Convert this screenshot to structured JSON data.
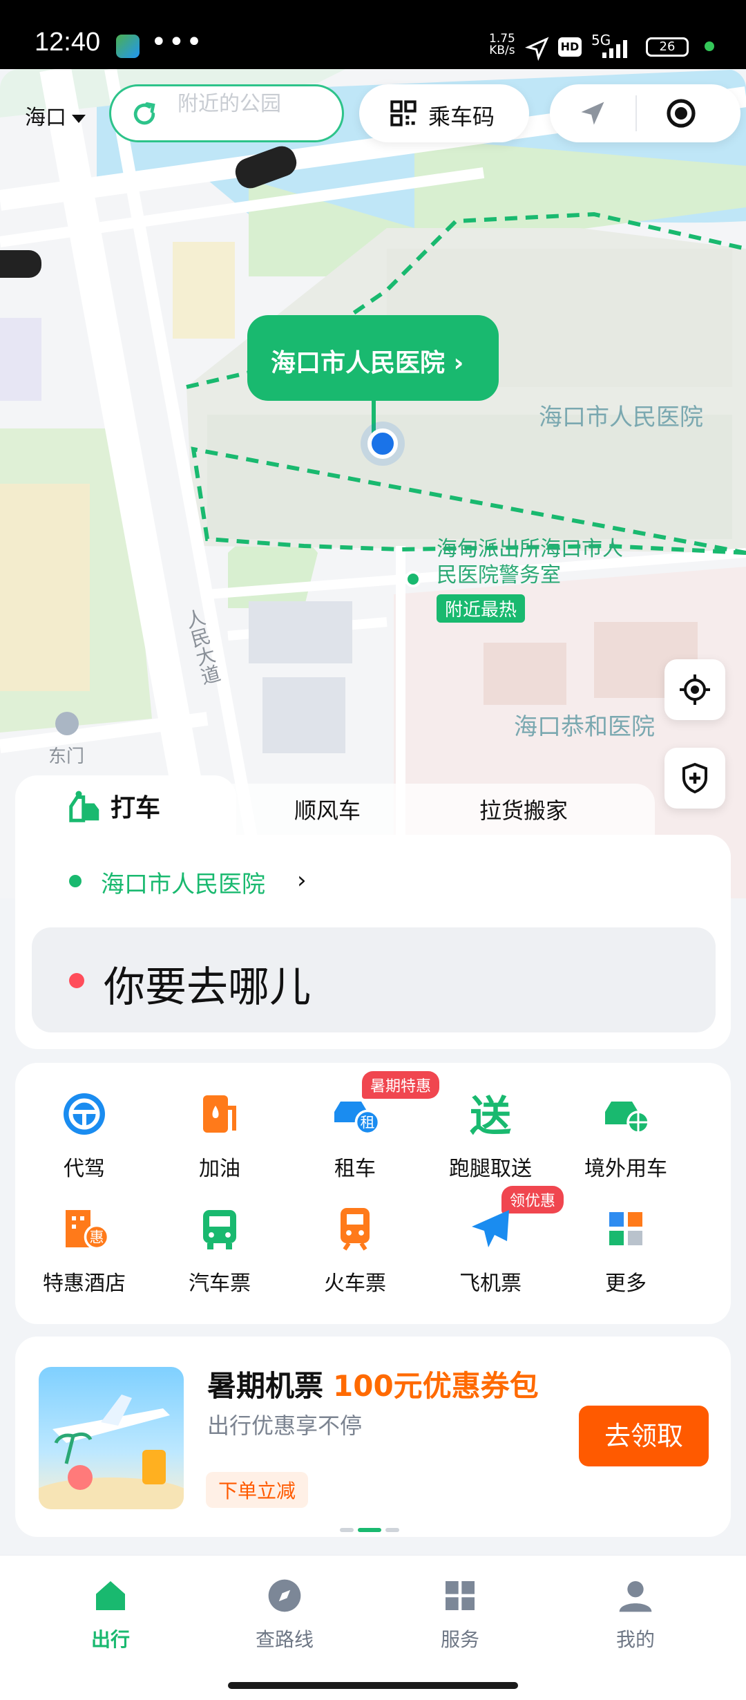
{
  "status": {
    "time": "12:40",
    "dots": "•••",
    "net_speed": "1.75",
    "net_unit": "KB/s",
    "hd": "HD",
    "signal": "5G",
    "battery": "26"
  },
  "topbar": {
    "city": "海口",
    "search_placeholder": "附近的公园",
    "ride_code": "乘车码"
  },
  "map": {
    "pin_label": "海口市人民医院 ›",
    "labels": {
      "hospital": "海口市人民医院",
      "police_line1": "海甸派出所海口市人",
      "police_line2": "民医院警务室",
      "hot_tag": "附近最热",
      "gonghe": "海口恭和医院",
      "road": "人民大道",
      "gate": "东门"
    }
  },
  "ride_tabs": {
    "ride": "打车",
    "hitch": "顺风车",
    "move": "拉货搬家"
  },
  "ride": {
    "origin": "海口市人民医院",
    "origin_chevron": "›",
    "destination_placeholder": "你要去哪儿"
  },
  "services": [
    {
      "label": "代驾",
      "icon": "steering-wheel-icon",
      "badge": ""
    },
    {
      "label": "加油",
      "icon": "fuel-pump-icon",
      "badge": ""
    },
    {
      "label": "租车",
      "icon": "rental-car-icon",
      "badge": "暑期特惠"
    },
    {
      "label": "跑腿取送",
      "icon": "delivery-icon",
      "badge": ""
    },
    {
      "label": "境外用车",
      "icon": "overseas-car-icon",
      "badge": ""
    },
    {
      "label": "特惠酒店",
      "icon": "hotel-icon",
      "badge": ""
    },
    {
      "label": "汽车票",
      "icon": "bus-icon",
      "badge": ""
    },
    {
      "label": "火车票",
      "icon": "train-icon",
      "badge": ""
    },
    {
      "label": "飞机票",
      "icon": "airplane-icon",
      "badge": "领优惠"
    },
    {
      "label": "更多",
      "icon": "grid-more-icon",
      "badge": ""
    }
  ],
  "promo": {
    "title_prefix": "暑期机票",
    "title_highlight": "100元优惠券包",
    "subtitle": "出行优惠享不停",
    "tag": "下单立减",
    "cta": "去领取"
  },
  "nav": [
    {
      "label": "出行",
      "icon": "home-icon",
      "active": true
    },
    {
      "label": "查路线",
      "icon": "compass-icon",
      "active": false
    },
    {
      "label": "服务",
      "icon": "grid-icon",
      "active": false
    },
    {
      "label": "我的",
      "icon": "person-icon",
      "active": false
    }
  ],
  "colors": {
    "brand_green": "#19b96f",
    "accent_orange": "#ff5a00",
    "badge_red": "#f0464f"
  }
}
